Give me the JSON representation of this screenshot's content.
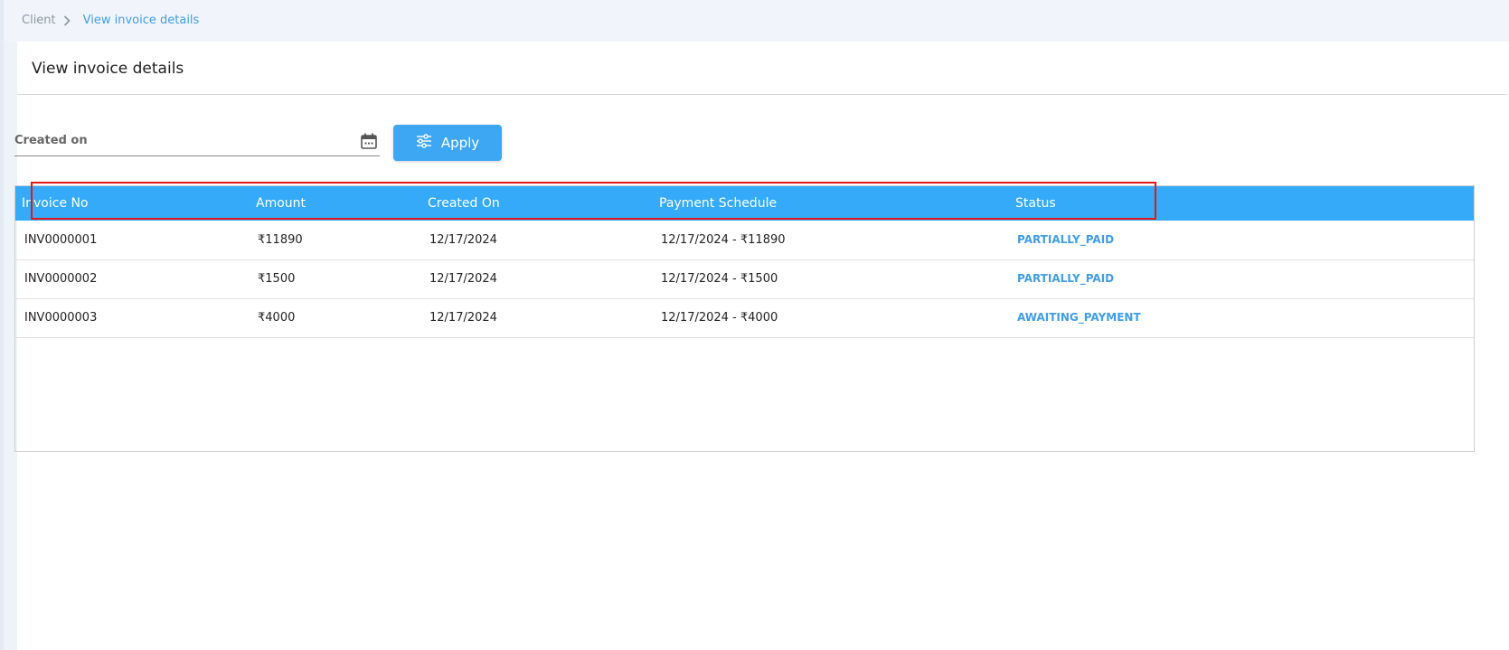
{
  "breadcrumb": {
    "root": "Client",
    "current": "View invoice details"
  },
  "page": {
    "title": "View invoice details"
  },
  "filter": {
    "created_on_label": "Created on",
    "apply_label": "Apply"
  },
  "table": {
    "headers": [
      "Invoice No",
      "Amount",
      "Created On",
      "Payment Schedule",
      "Status"
    ],
    "rows": [
      {
        "invoice_no": "INV0000001",
        "amount": "₹11890",
        "created_on": "12/17/2024",
        "payment_schedule": "12/17/2024 - ₹11890",
        "status": "PARTIALLY_PAID"
      },
      {
        "invoice_no": "INV0000002",
        "amount": "₹1500",
        "created_on": "12/17/2024",
        "payment_schedule": "12/17/2024 - ₹1500",
        "status": "PARTIALLY_PAID"
      },
      {
        "invoice_no": "INV0000003",
        "amount": "₹4000",
        "created_on": "12/17/2024",
        "payment_schedule": "12/17/2024 - ₹4000",
        "status": "AWAITING_PAYMENT"
      }
    ]
  },
  "colors": {
    "accent": "#3ea7f4",
    "header_bg": "#35aaf8",
    "status_text": "#3f9ee8",
    "highlight": "#e01a1a"
  },
  "icons": {
    "breadcrumb_separator": "chevron-right-icon",
    "date_picker": "calendar-icon",
    "apply": "sliders-icon"
  }
}
